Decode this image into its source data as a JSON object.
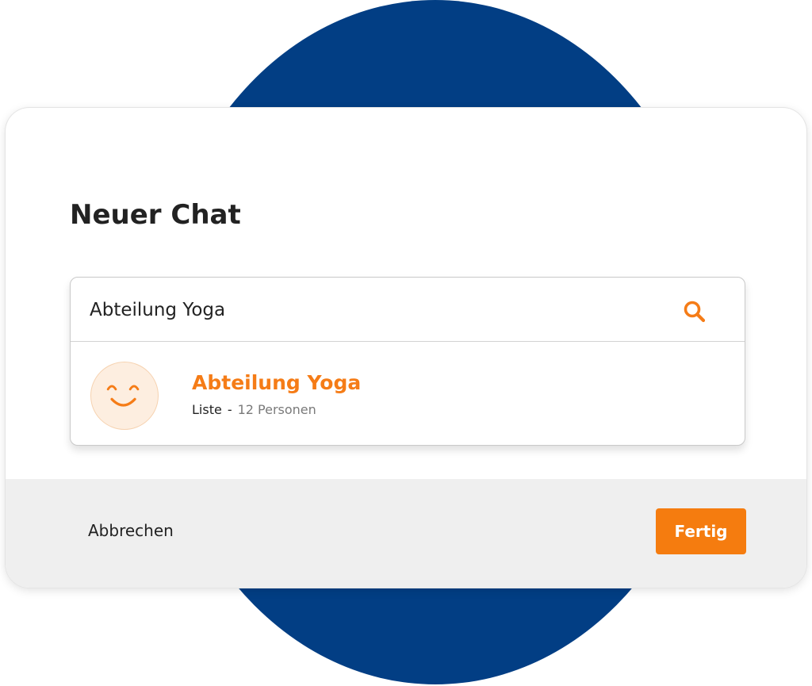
{
  "dialog": {
    "title": "Neuer Chat"
  },
  "search": {
    "value": "Abteilung Yoga",
    "icon": "search-icon"
  },
  "results": [
    {
      "avatar_icon": "smiley-icon",
      "title": "Abteilung Yoga",
      "type": "Liste",
      "separator": "-",
      "count_label": "12 Personen"
    }
  ],
  "footer": {
    "cancel_label": "Abbrechen",
    "done_label": "Fertig"
  },
  "colors": {
    "accent": "#f57c17",
    "background_circle": "#023e84",
    "footer_background": "#efefef",
    "avatar_background": "#fdeee0"
  }
}
